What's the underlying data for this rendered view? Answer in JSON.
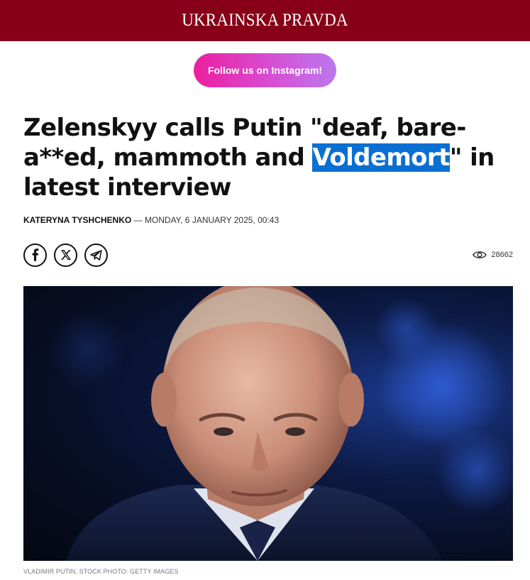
{
  "header": {
    "logo": "UKRAINSKA PRAVDA"
  },
  "promo": {
    "instagram_label": "Follow us on Instagram!"
  },
  "article": {
    "title_before": "Zelenskyy calls Putin \"deaf, bare-a**ed, mammoth and ",
    "title_highlight": "Voldemort",
    "title_after": "\" in latest interview",
    "author": "KATERYNA TYSHCHENKO",
    "byline_sep": " — ",
    "date": "MONDAY, 6 JANUARY 2025, 00:43",
    "views": "28662",
    "caption": "VLADIMIR PUTIN. STOCK PHOTO: GETTY IMAGES"
  },
  "share": {
    "icons": [
      "facebook-icon",
      "x-icon",
      "telegram-icon"
    ]
  },
  "colors": {
    "header_bg": "#870018",
    "highlight_bg": "#0a6fd3",
    "instagram_gradient_start": "#ec1f9f",
    "instagram_gradient_end": "#bb78ee"
  }
}
